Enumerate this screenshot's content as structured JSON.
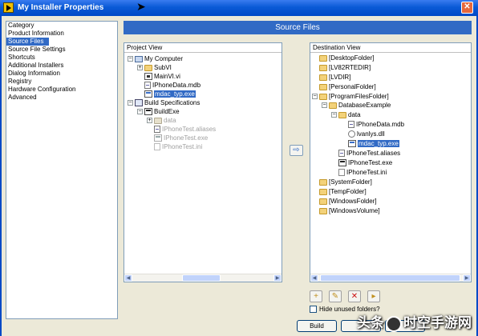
{
  "window": {
    "title": "My Installer Properties",
    "close_glyph": "✕"
  },
  "categories": {
    "items": [
      "Category",
      "Product Information",
      "Source Files",
      "Source File Settings",
      "Shortcuts",
      "Additional Installers",
      "Dialog Information",
      "Registry",
      "Hardware Configuration",
      "Advanced"
    ],
    "selected": "Source Files"
  },
  "header": {
    "title": "Source Files"
  },
  "project_view": {
    "title": "Project View",
    "tree": {
      "my_computer": "My Computer",
      "subvi": "SubVI",
      "mainvi": "MainVI.vi",
      "iphonedata": "IPhoneData.mdb",
      "mdac": "mdac_typ.exe",
      "build_specs": "Build Specifications",
      "buildexe": "BuildExe",
      "data": "data",
      "aliases": "IPhoneTest.aliases",
      "exe": "IPhoneTest.exe",
      "ini": "IPhoneTest.ini"
    }
  },
  "destination_view": {
    "title": "Destination View",
    "tree": {
      "desktop": "[DesktopFolder]",
      "lv82rtedir": "[LV82RTEDIR]",
      "lvdir": "[LVDIR]",
      "personal": "[PersonalFolder]",
      "programfiles": "[ProgramFilesFolder]",
      "dbexample": "DatabaseExample",
      "data": "data",
      "iphonedata": "IPhoneData.mdb",
      "lvanlys": "lvanlys.dll",
      "mdac": "mdac_typ.exe",
      "aliases": "IPhoneTest.aliases",
      "exe": "IPhoneTest.exe",
      "ini": "IPhoneTest.ini",
      "system": "[SystemFolder]",
      "temp": "[TempFolder]",
      "windows": "[WindowsFolder]",
      "winvolume": "[WindowsVolume]"
    }
  },
  "move_button": {
    "glyph": "⇨"
  },
  "toolbar": {
    "new_folder_glyph": "+",
    "rename_glyph": "✎",
    "delete_glyph": "✕",
    "open_glyph": "▸"
  },
  "hide_unused": {
    "label": "Hide unused folders?",
    "checked": false
  },
  "footer": {
    "build_label": "Build"
  },
  "watermark": {
    "text_left": "头条",
    "text_right": "时空手游网"
  }
}
